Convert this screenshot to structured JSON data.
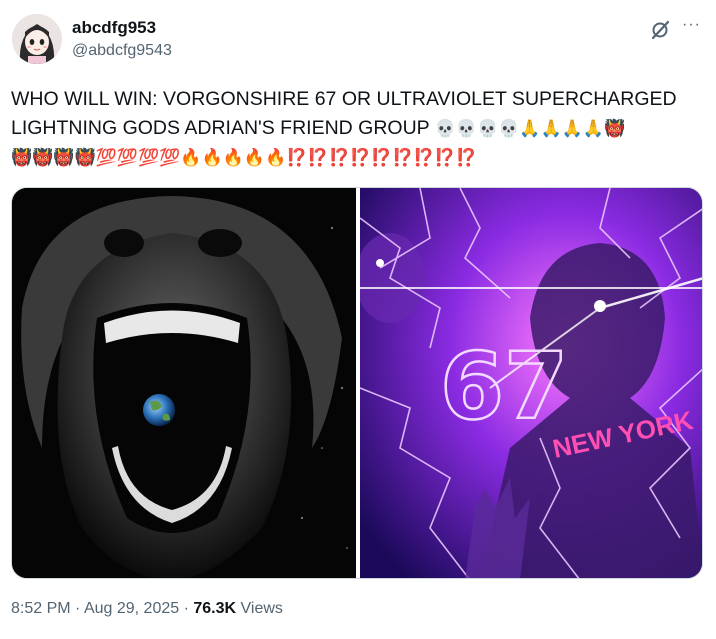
{
  "author": {
    "display_name": "abcdfg953",
    "handle": "@abdcfg9543",
    "avatar_icon": "anime-girl-avatar"
  },
  "header_icons": {
    "grok": "grok-slash-circle-icon",
    "more": "···"
  },
  "tweet": {
    "text_line1": "WHO WILL WIN: VORGONSHIRE 67 OR ULTRAVIOLET SUPERCHARGED",
    "text_line2": "LIGHTNING GODS ADRIAN'S FRIEND GROUP",
    "emoji_line2": "💀💀💀💀🙏🙏🙏🙏👹",
    "emoji_line3": "👹👹👹👹💯💯💯💯🔥🔥🔥🔥🔥⁉️⁉️⁉️⁉️⁉️⁉️⁉️⁉️⁉️"
  },
  "media": {
    "left_image": "grayscale-screaming-face-with-earth-in-mouth",
    "right_image": "purple-lightning-67-new-york",
    "right_overlay_67": "67",
    "right_overlay_text": "NEW YORK"
  },
  "meta": {
    "time": "8:52 PM",
    "sep1": " · ",
    "date": "Aug 29, 2025",
    "sep2": " · ",
    "views_count": "76.3K",
    "views_label": " Views"
  },
  "colors": {
    "text_primary": "#0f1419",
    "text_secondary": "#536471",
    "border": "#cfd9de"
  }
}
